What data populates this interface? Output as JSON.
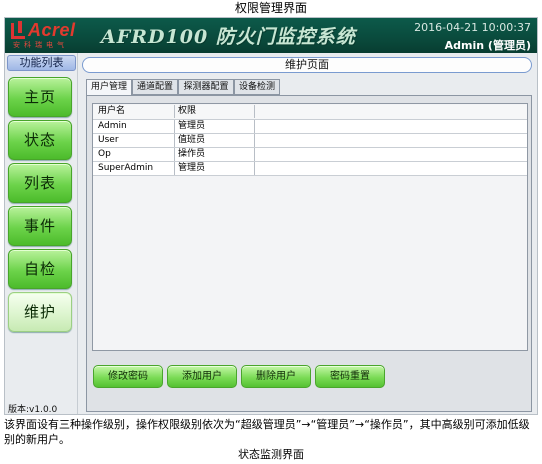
{
  "caption_top": "权限管理界面",
  "header": {
    "logo_text": "Acrel",
    "logo_sub": "安科瑞电气",
    "system_title": "AFRD100 防火门监控系统",
    "datetime": "2016-04-21 10:00:37",
    "user": "Admin (管理员)"
  },
  "sidebar": {
    "title": "功能列表",
    "items": [
      {
        "label": "主页"
      },
      {
        "label": "状态"
      },
      {
        "label": "列表"
      },
      {
        "label": "事件"
      },
      {
        "label": "自检"
      },
      {
        "label": "维护"
      }
    ],
    "version": "版本:v1.0.0"
  },
  "main": {
    "page_title": "维护页面",
    "tabs": [
      {
        "label": "用户管理"
      },
      {
        "label": "通道配置"
      },
      {
        "label": "探测器配置"
      },
      {
        "label": "设备检测"
      }
    ],
    "table": {
      "columns": [
        "用户名",
        "权限"
      ],
      "rows": [
        [
          "Admin",
          "管理员"
        ],
        [
          "User",
          "值班员"
        ],
        [
          "Op",
          "操作员"
        ],
        [
          "SuperAdmin",
          "管理员"
        ]
      ]
    },
    "actions": [
      {
        "label": "修改密码"
      },
      {
        "label": "添加用户"
      },
      {
        "label": "删除用户"
      },
      {
        "label": "密码重置"
      }
    ]
  },
  "note": "该界面设有三种操作级别，操作权限级别依次为“超级管理员”→“管理员”→“操作员”，其中高级别可添加低级别的新用户。",
  "caption_bottom": "状态监测界面",
  "colors": {
    "titlebar": "#0a4a3c",
    "nav_green": "#6cd34a",
    "logo_red": "#e33a2e",
    "accent_blue": "#7a9bd0"
  }
}
